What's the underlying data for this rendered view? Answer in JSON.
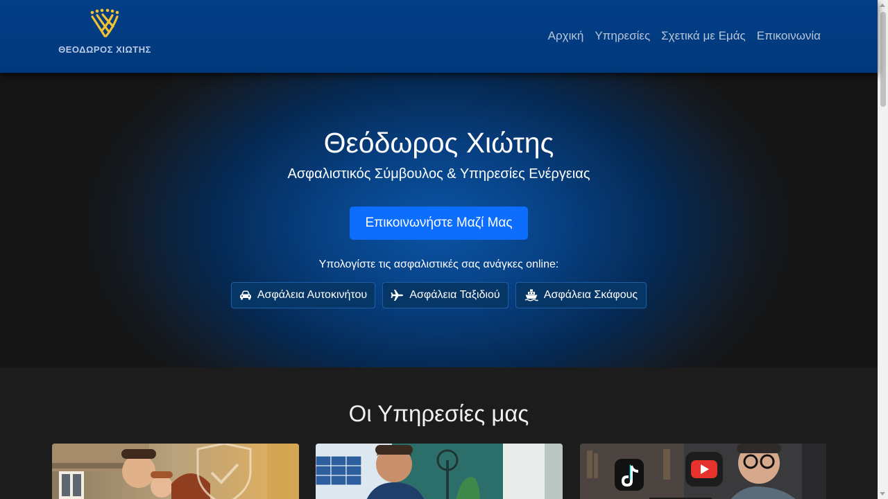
{
  "brand": {
    "name": "ΘΕΟΔΩΡΟΣ ΧΙΩΤΗΣ",
    "logo_icon": "shield-logo-icon"
  },
  "nav": [
    {
      "label": "Αρχική"
    },
    {
      "label": "Υπηρεσίες"
    },
    {
      "label": "Σχετικά με Εμάς"
    },
    {
      "label": "Επικοινωνία"
    }
  ],
  "hero": {
    "title": "Θεόδωρος Χιώτης",
    "subtitle": "Ασφαλιστικός Σύμβουλος & Υπηρεσίες Ενέργειας",
    "cta_label": "Επικοινωνήστε Μαζί Μας",
    "calc_label": "Υπολογίστε τις ασφαλιστικές σας ανάγκες online:",
    "calc_buttons": [
      {
        "label": "Ασφάλεια Αυτοκινήτου",
        "icon": "car-icon"
      },
      {
        "label": "Ασφάλεια Ταξιδιού",
        "icon": "plane-icon"
      },
      {
        "label": "Ασφάλεια Σκάφους",
        "icon": "ship-icon"
      }
    ]
  },
  "services": {
    "title": "Οι Υπηρεσίες μας",
    "cards": [
      {
        "image": "family-insurance-image"
      },
      {
        "image": "energy-solar-image"
      },
      {
        "image": "social-media-image"
      }
    ]
  },
  "colors": {
    "navbar": "#033e86",
    "accent": "#0d6efd",
    "logo": "#f2c230",
    "calc_button": "#063666"
  }
}
